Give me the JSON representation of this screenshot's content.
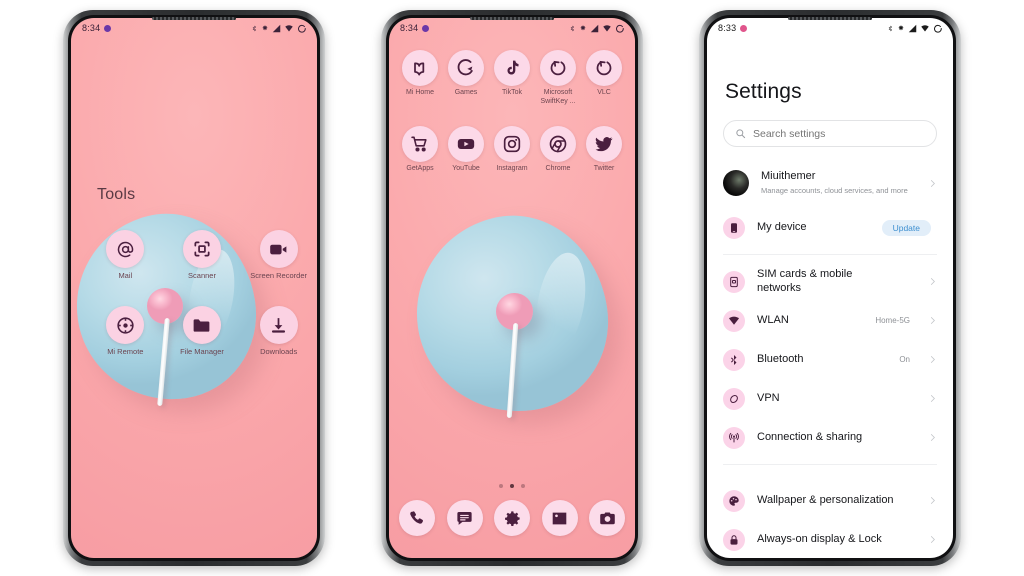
{
  "page": {
    "background": "#ffffff",
    "wallpaper_color": "#fbaaad",
    "accent_icon_bg": "#fbd3e8",
    "accent_icon_fg": "#4a1e3e"
  },
  "phone1": {
    "status": {
      "time": "8:34",
      "icons": [
        "bluetooth-icon",
        "vibrate-icon",
        "signal-icon",
        "wifi-icon",
        "battery-icon"
      ]
    },
    "folder": {
      "title": "Tools",
      "apps": [
        {
          "label": "Mail",
          "icon": "at-icon"
        },
        {
          "label": "Scanner",
          "icon": "scanner-icon"
        },
        {
          "label": "Screen Recorder",
          "icon": "video-camera-icon"
        },
        {
          "label": "Mi Remote",
          "icon": "remote-icon"
        },
        {
          "label": "File Manager",
          "icon": "folder-icon"
        },
        {
          "label": "Downloads",
          "icon": "download-icon"
        }
      ]
    }
  },
  "phone2": {
    "status": {
      "time": "8:34"
    },
    "apps_row1": [
      {
        "label": "Mi Home",
        "icon": "mi-home-icon"
      },
      {
        "label": "Games",
        "icon": "games-icon"
      },
      {
        "label": "TikTok",
        "icon": "tiktok-icon"
      },
      {
        "label": "Microsoft SwiftKey ...",
        "icon": "swiftkey-icon"
      },
      {
        "label": "VLC",
        "icon": "vlc-icon"
      }
    ],
    "apps_row2": [
      {
        "label": "GetApps",
        "icon": "cart-icon"
      },
      {
        "label": "YouTube",
        "icon": "youtube-icon"
      },
      {
        "label": "Instagram",
        "icon": "instagram-icon"
      },
      {
        "label": "Chrome",
        "icon": "chrome-icon"
      },
      {
        "label": "Twitter",
        "icon": "twitter-icon"
      }
    ],
    "page_dots": {
      "count": 3,
      "active_index": 1
    },
    "dock": [
      {
        "label": "Phone",
        "icon": "phone-icon"
      },
      {
        "label": "Messages",
        "icon": "message-icon"
      },
      {
        "label": "Settings",
        "icon": "gear-icon"
      },
      {
        "label": "Gallery",
        "icon": "image-icon"
      },
      {
        "label": "Camera",
        "icon": "camera-icon"
      }
    ]
  },
  "phone3": {
    "status": {
      "time": "8:33"
    },
    "title": "Settings",
    "search": {
      "placeholder": "Search settings",
      "value": "",
      "icon": "search-icon"
    },
    "account": {
      "name": "Miuithemer",
      "subtitle": "Manage accounts, cloud services, and more",
      "icon": "avatar"
    },
    "device": {
      "label": "My device",
      "badge": "Update",
      "badge_color": "#3e8fd0",
      "icon": "device-icon"
    },
    "items": [
      {
        "label": "SIM cards & mobile networks",
        "value": "",
        "icon": "sim-icon"
      },
      {
        "label": "WLAN",
        "value": "Home-5G",
        "icon": "wifi-icon"
      },
      {
        "label": "Bluetooth",
        "value": "On",
        "icon": "bluetooth-icon"
      },
      {
        "label": "VPN",
        "value": "",
        "icon": "vpn-icon"
      },
      {
        "label": "Connection & sharing",
        "value": "",
        "icon": "broadcast-icon"
      }
    ],
    "items2": [
      {
        "label": "Wallpaper & personalization",
        "value": "",
        "icon": "palette-icon"
      },
      {
        "label": "Always-on display & Lock",
        "value": "",
        "icon": "lock-icon"
      }
    ]
  }
}
